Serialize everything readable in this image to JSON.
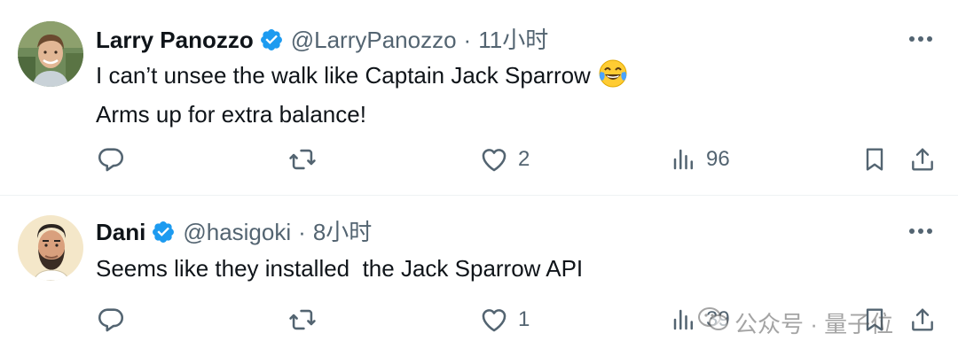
{
  "tweets": [
    {
      "author": {
        "name": "Larry Panozzo",
        "handle": "@LarryPanozzo",
        "verified": true,
        "avatar_icon": "avatar-photo"
      },
      "separator": "·",
      "time": "11小时",
      "text_lines": [
        "I can’t unsee the walk like Captain Jack Sparrow",
        "Arms up for extra balance!"
      ],
      "emoji": "face-with-tears-of-joy",
      "metrics": {
        "replies": "",
        "reposts": "",
        "likes": "2",
        "views": "96"
      }
    },
    {
      "author": {
        "name": "Dani",
        "handle": "@hasigoki",
        "verified": true,
        "avatar_icon": "avatar-illustration"
      },
      "separator": "·",
      "time": "8小时",
      "text_lines": [
        "Seems like they installed  the Jack Sparrow API"
      ],
      "metrics": {
        "replies": "",
        "reposts": "",
        "likes": "1",
        "views": "39"
      }
    }
  ],
  "watermark": {
    "text": "公众号 · 量子位",
    "icon": "wechat-icon"
  },
  "colors": {
    "text_primary": "#0f1419",
    "text_secondary": "#536471",
    "verified_blue": "#1d9bf0",
    "divider": "#eff3f4"
  }
}
